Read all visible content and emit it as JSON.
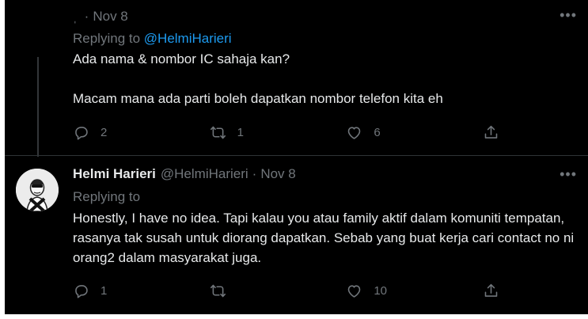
{
  "tweets": [
    {
      "name": "",
      "handle": "",
      "handle_cut": "ˌ",
      "separator": "·",
      "time": "Nov 8",
      "replying_prefix": "Replying to ",
      "replying_to": "@HelmiHarieri",
      "text": [
        "Ada nama & nombor IC sahaja kan?",
        "Macam mana ada parti boleh dapatkan nombor telefon kita eh"
      ],
      "actions": {
        "reply_count": "2",
        "retweet_count": "1",
        "like_count": "6"
      },
      "more_icon": "more-horizontal-icon"
    },
    {
      "name": "Helmi Harieri",
      "handle": "@HelmiHarieri",
      "separator": "·",
      "time": "Nov 8",
      "replying_prefix": "Replying to",
      "replying_to": "",
      "text": [
        "Honestly, I have no idea. Tapi kalau you atau family aktif dalam komuniti tempatan, rasanya tak susah untuk diorang dapatkan. Sebab yang buat kerja cari contact no ni orang2 dalam masyarakat juga."
      ],
      "actions": {
        "reply_count": "1",
        "retweet_count": "",
        "like_count": "10"
      },
      "more_icon": "more-horizontal-icon"
    }
  ],
  "icons": {
    "reply": "reply-icon",
    "retweet": "retweet-icon",
    "like": "heart-icon",
    "share": "share-icon",
    "more": "more-horizontal-icon"
  },
  "theme": {
    "background": "#000000",
    "text": "#e7e9ea",
    "muted": "#71767b",
    "accent": "#1d9bf0"
  }
}
